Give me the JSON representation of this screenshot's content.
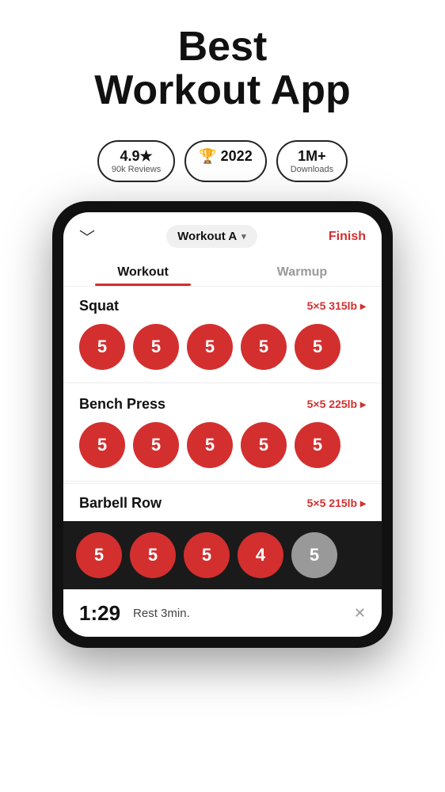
{
  "header": {
    "title_line1": "Best",
    "title_line2": "Workout App"
  },
  "badges": [
    {
      "id": "rating",
      "main": "4.9★",
      "sub": "90k Reviews"
    },
    {
      "id": "award",
      "icon": "🏆",
      "main": "2022",
      "sub": ""
    },
    {
      "id": "downloads",
      "main": "1M+",
      "sub": "Downloads"
    }
  ],
  "app": {
    "back_arrow": "﹀",
    "workout_name": "Workout A",
    "finish_label": "Finish",
    "tabs": [
      {
        "id": "workout",
        "label": "Workout",
        "active": true
      },
      {
        "id": "warmup",
        "label": "Warmup",
        "active": false
      }
    ],
    "exercises": [
      {
        "id": "squat",
        "name": "Squat",
        "sets_label": "5×5 315lb ▸",
        "sets": [
          5,
          5,
          5,
          5,
          5
        ],
        "grey_index": -1
      },
      {
        "id": "bench-press",
        "name": "Bench Press",
        "sets_label": "5×5 225lb ▸",
        "sets": [
          5,
          5,
          5,
          5,
          5
        ],
        "grey_index": -1
      },
      {
        "id": "barbell-row",
        "name": "Barbell Row",
        "sets_label": "5×5 215lb ▸",
        "sets": [
          5,
          5,
          5,
          4,
          5
        ],
        "grey_index": 4
      }
    ],
    "rest_timer": {
      "time": "1:29",
      "label": "Rest 3min.",
      "close": "✕"
    }
  }
}
